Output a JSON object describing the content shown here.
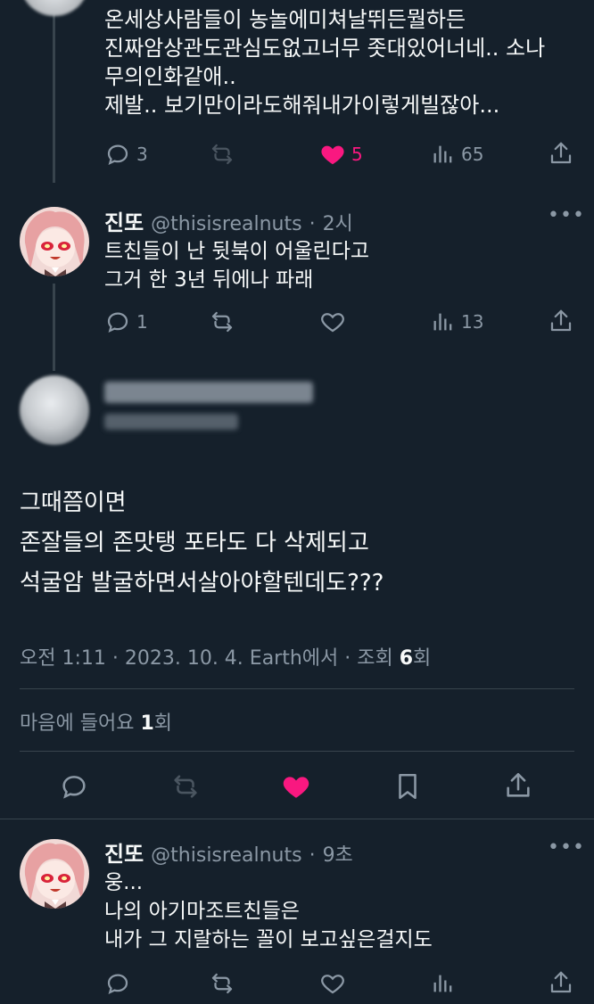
{
  "reply1": {
    "text": "온세상사람들이 농놀에미쳐날뛰든뭘하든\n진짜암상관도관심도없고너무 좃대있어너네.. 소나\n무의인화같애..\n제발.. 보기만이라도해줘내가이렇게빌잖아...",
    "replies": "3",
    "likes": "5",
    "views": "65"
  },
  "reply2": {
    "name": "진또",
    "handle": "@thisisrealnuts",
    "time": "2시",
    "text": "트친들이 난 뒷북이 어울린다고\n그거 한 3년 뒤에나 파래",
    "replies": "1",
    "views": "13"
  },
  "main": {
    "text": "그때쯤이면\n존잘들의 존맛탱 포타도 다 삭제되고\n석굴암 발굴하면서살아야할텐데도???",
    "meta_prefix": "오전 1:11 · 2023. 10. 4. Earth에서 · 조회 ",
    "views_count": "6",
    "views_suffix": "회",
    "likes_prefix": "마음에 들어요 ",
    "likes_count": "1",
    "likes_suffix": "회"
  },
  "reply3": {
    "name": "진또",
    "handle": "@thisisrealnuts",
    "time": "9초",
    "text": "웅...\n나의 아기마조트친들은\n내가 그 지랄하는 꼴이 보고싶은걸지도"
  },
  "colors": {
    "background": "#15202b",
    "like_active": "#f91880",
    "secondary_text": "#8b98a5",
    "divider": "#38444d"
  },
  "icons": [
    "reply-icon",
    "retweet-icon",
    "heart-icon",
    "views-icon",
    "share-icon",
    "bookmark-icon",
    "more-icon"
  ]
}
